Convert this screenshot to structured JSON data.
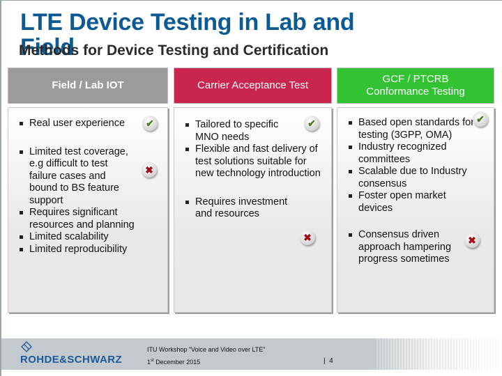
{
  "slide": {
    "title": "LTE Device Testing in Lab and Field",
    "subtitle": "Methods for Device Testing and Certification"
  },
  "columns": [
    {
      "header": "Field / Lab IOT",
      "header_color": "#9b9b9b",
      "items": [
        "Real user experience",
        "Limited test coverage, e.g difficult to test failure cases and bound to BS feature support",
        "Requires significant resources and planning",
        "Limited scalability",
        "Limited reproducibility"
      ],
      "badges": [
        {
          "type": "check",
          "icon": "check-icon"
        },
        {
          "type": "cross",
          "icon": "cross-icon"
        }
      ]
    },
    {
      "header": "Carrier Acceptance Test",
      "header_color": "#c8254f",
      "items": [
        "Tailored to specific MNO needs",
        "Flexible and fast delivery of test solutions suitable for new technology introduction",
        "Requires investment and resources"
      ],
      "badges": [
        {
          "type": "check",
          "icon": "check-icon"
        },
        {
          "type": "cross",
          "icon": "cross-icon"
        }
      ]
    },
    {
      "header": "GCF / PTCRB Conformance Testing",
      "header_color": "#33c233",
      "items": [
        "Based open standards for testing (3GPP, OMA)",
        "Industry recognized committees",
        "Scalable due to Industry consensus",
        "Foster open market devices",
        "Consensus driven approach hampering progress sometimes"
      ],
      "badges": [
        {
          "type": "check",
          "icon": "check-icon"
        },
        {
          "type": "cross",
          "icon": "cross-icon"
        }
      ]
    }
  ],
  "badge_glyphs": {
    "check": "✔",
    "cross": "✖"
  },
  "footer": {
    "logo_text": "ROHDE&SCHWARZ",
    "event": "ITU Workshop \"Voice and Video over LTE\"",
    "date_day": "1",
    "date_suffix": "st",
    "date_rest": " December 2015",
    "page_separator": "|",
    "page_number": "4"
  }
}
